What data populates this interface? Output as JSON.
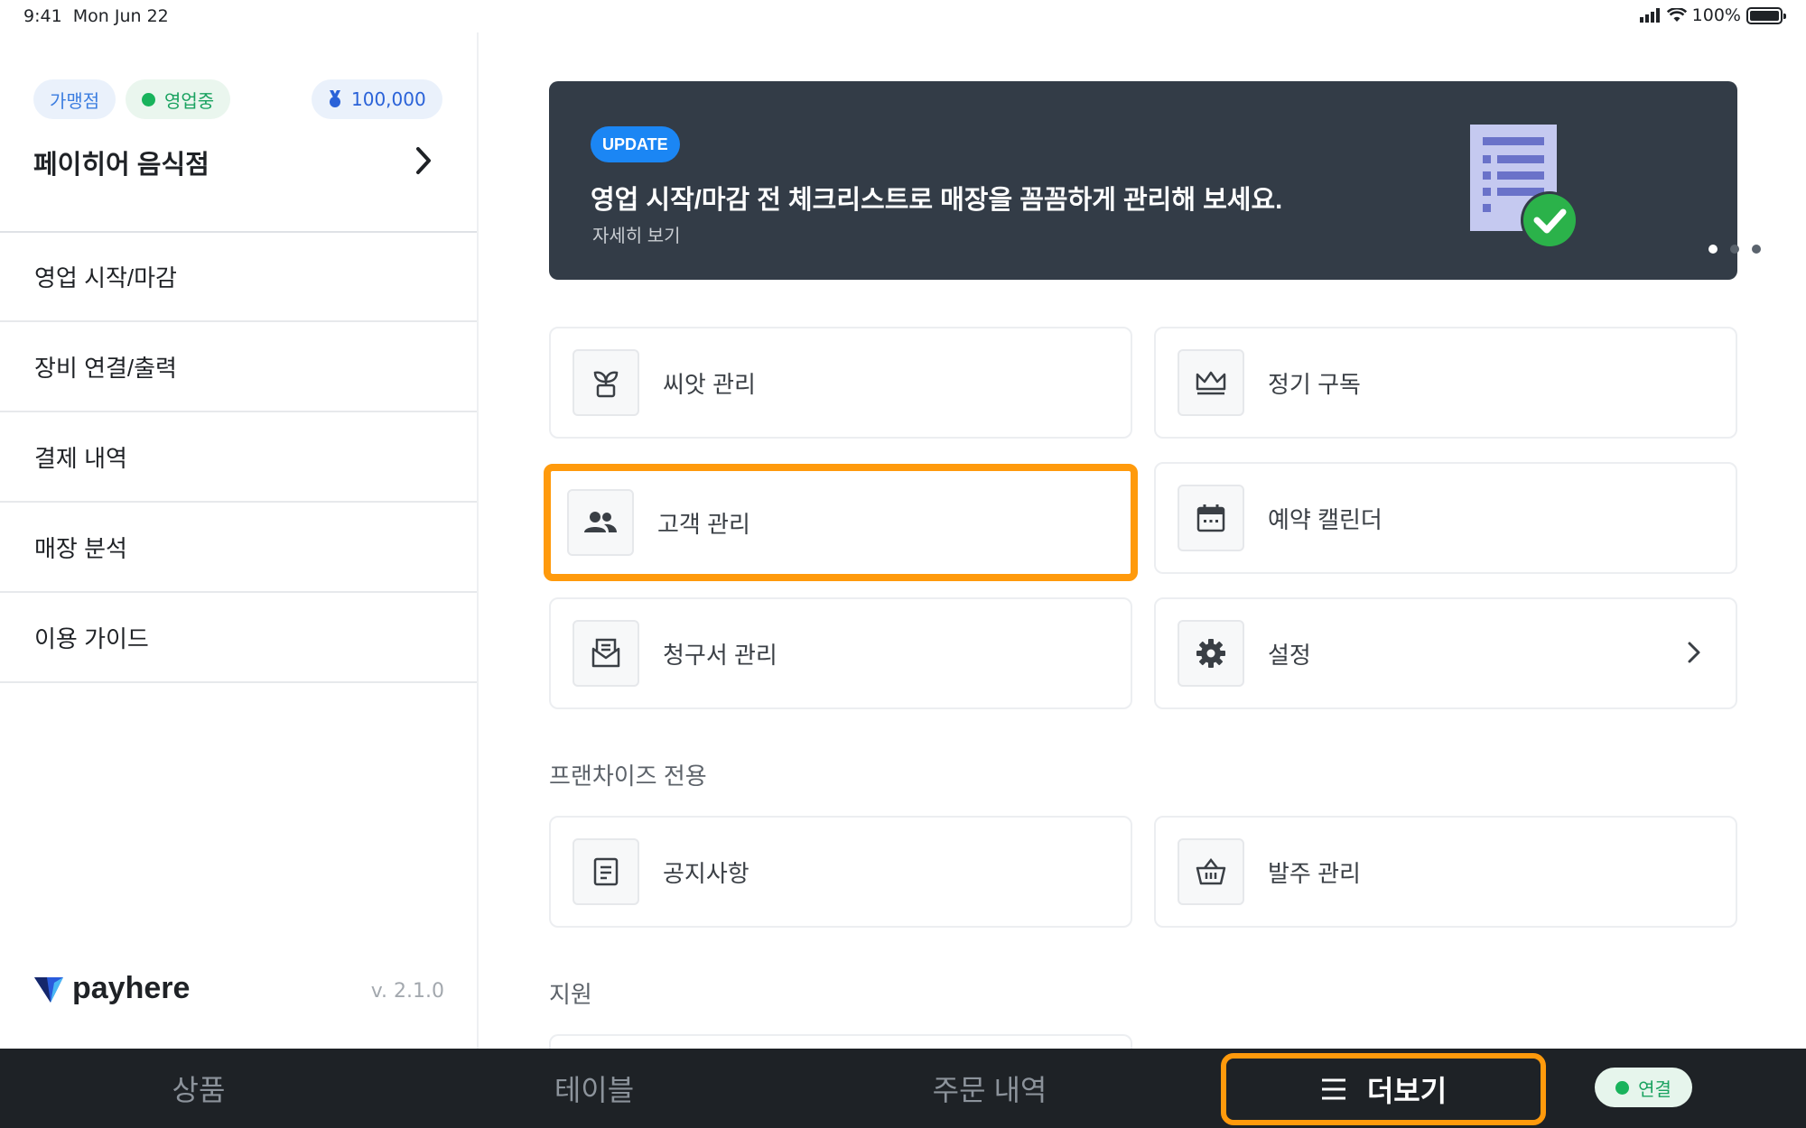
{
  "status_bar": {
    "time": "9:41",
    "date": "Mon Jun 22",
    "battery": "100%"
  },
  "sidebar": {
    "franchise_chip": "가맹점",
    "status_chip": "영업중",
    "points": "100,000",
    "store_name": "페이히어 음식점",
    "menu": [
      {
        "label": "영업 시작/마감"
      },
      {
        "label": "장비 연결/출력"
      },
      {
        "label": "결제 내역"
      },
      {
        "label": "매장 분석"
      },
      {
        "label": "이용 가이드"
      }
    ],
    "brand": "payhere",
    "version": "v. 2.1.0"
  },
  "banner": {
    "badge": "UPDATE",
    "title": "영업 시작/마감 전 체크리스트로 매장을 꼼꼼하게 관리해 보세요.",
    "link": "자세히 보기",
    "page_count": 3,
    "active_page": 1
  },
  "menu_cards": [
    {
      "label": "씨앗 관리",
      "icon": "sprout-icon"
    },
    {
      "label": "정기 구독",
      "icon": "crown-icon"
    },
    {
      "label": "고객 관리",
      "icon": "people-icon"
    },
    {
      "label": "예약 캘린더",
      "icon": "calendar-icon"
    },
    {
      "label": "청구서 관리",
      "icon": "invoice-icon"
    },
    {
      "label": "설정",
      "icon": "gear-icon"
    }
  ],
  "franchise_section": {
    "title": "프랜차이즈 전용",
    "cards": [
      {
        "label": "공지사항",
        "icon": "notice-icon"
      },
      {
        "label": "발주 관리",
        "icon": "basket-icon"
      }
    ]
  },
  "support_section": {
    "title": "지원"
  },
  "tabbar": {
    "tabs": [
      {
        "label": "상품"
      },
      {
        "label": "테이블"
      },
      {
        "label": "주문 내역"
      },
      {
        "label": "더보기"
      }
    ],
    "connection": "연결"
  },
  "colors": {
    "accent_highlight": "#ff9a0c",
    "banner_bg": "#333c47",
    "badge_blue": "#1b86f4",
    "online_green": "#19b35c"
  }
}
